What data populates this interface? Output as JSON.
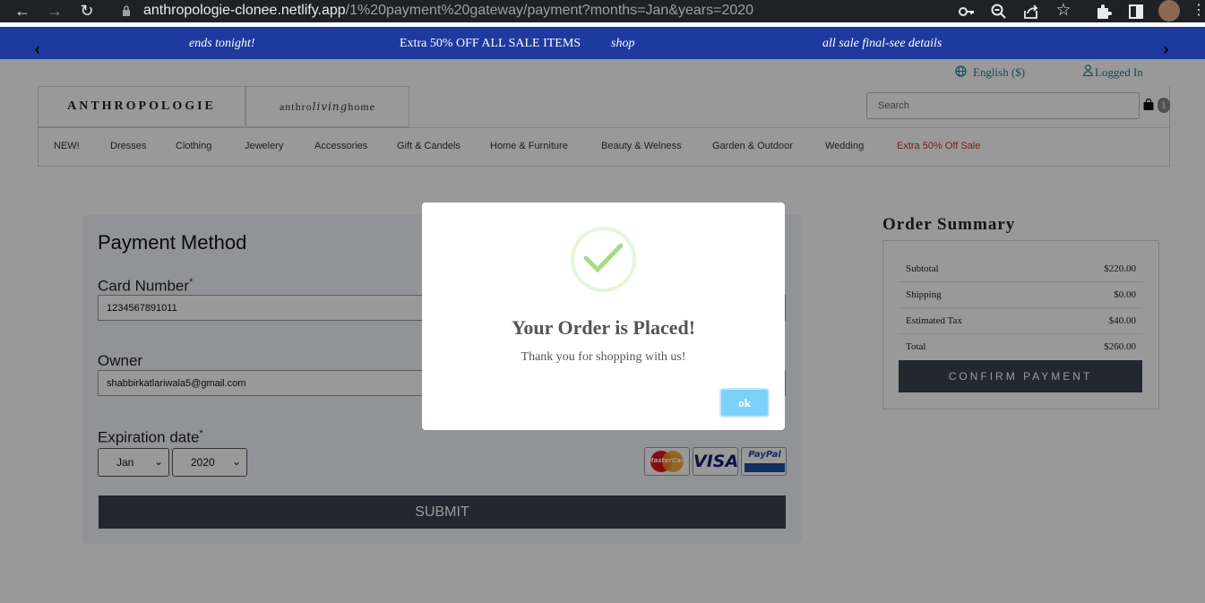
{
  "browser": {
    "url_host": "anthropologie-clonee.netlify.app",
    "url_path": "/1%20payment%20gateway/payment?months=Jan&years=2020"
  },
  "promo": {
    "items": [
      "ends tonight!",
      "Extra 50% OFF ALL SALE ITEMS",
      "shop",
      "all sale final-see details"
    ],
    "prev": "‹",
    "next": "›"
  },
  "utility": {
    "language": "English ($)",
    "account": "Logged In"
  },
  "header": {
    "logo": "ANTHROPOLOGIE",
    "sub_logo_left": "anthro",
    "sub_logo_mid": "living",
    "sub_logo_right": "home",
    "search_placeholder": "Search",
    "cart_count": "1"
  },
  "menu": [
    "NEW!",
    "Dresses",
    "Clothing",
    "Jewelery",
    "Accessories",
    "Gift & Candels",
    "Home & Furniture",
    "Beauty & Welness",
    "Garden & Outdoor",
    "Wedding",
    "Extra 50% Off Sale"
  ],
  "payment": {
    "title": "Payment Method",
    "card_label": "Card Number",
    "card_value": "1234567891011",
    "owner_label": "Owner",
    "owner_value": "shabbirkatlariwala5@gmail.com",
    "expiry_label": "Expiration date",
    "month": "Jan",
    "year": "2020",
    "submit": "SUBMIT",
    "required_mark": "*",
    "cards": [
      "MasterCard",
      "VISA",
      "PayPal"
    ]
  },
  "summary": {
    "title": "Order Summary",
    "rows": [
      {
        "label": "Subtotal",
        "value": "$220.00"
      },
      {
        "label": "Shipping",
        "value": "$0.00"
      },
      {
        "label": "Estimated Tax",
        "value": "$40.00"
      },
      {
        "label": "Total",
        "value": "$260.00"
      }
    ],
    "confirm": "CONFIRM PAYMENT"
  },
  "modal": {
    "title": "Your Order is Placed!",
    "text": "Thank you for shopping with us!",
    "ok": "ok"
  },
  "colors": {
    "promo_bg": "#1e3a9e",
    "dark_button": "#3a4150",
    "ok_button": "#7cd1f9",
    "sale_link": "#c0392b",
    "link_teal": "#1b7f8f"
  }
}
